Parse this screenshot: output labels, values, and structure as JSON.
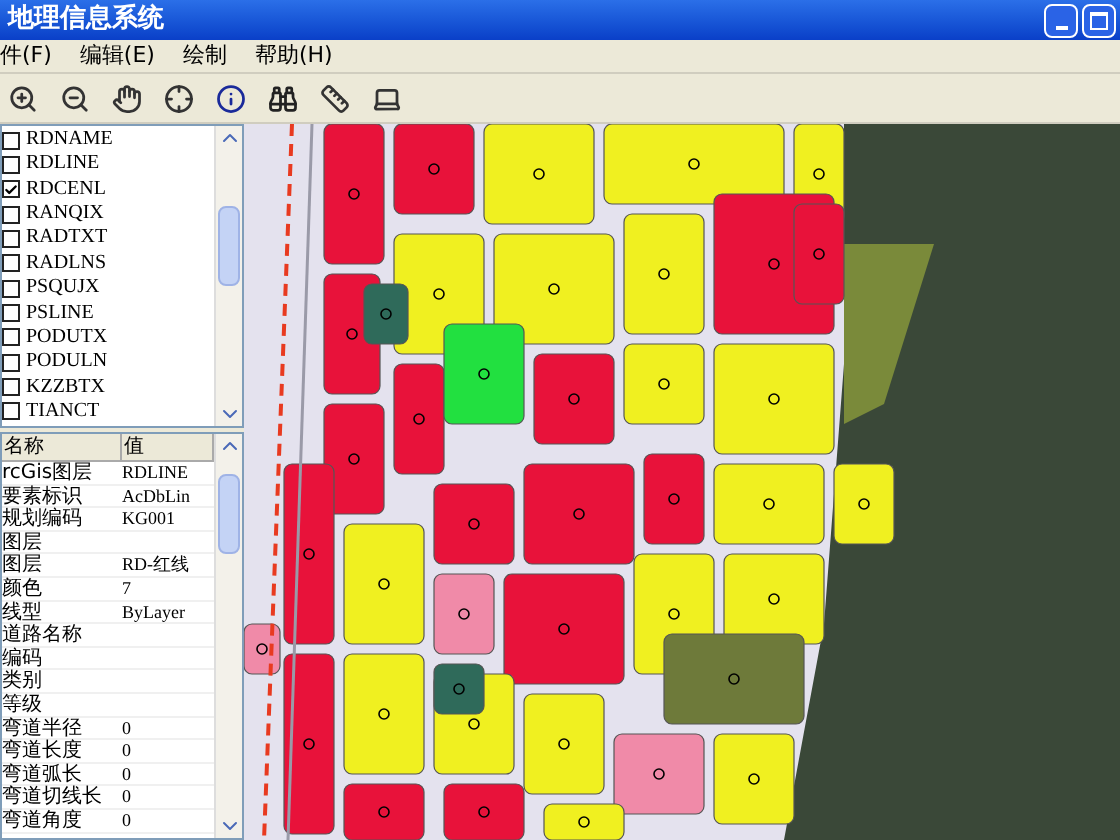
{
  "window": {
    "title": "地理信息系统"
  },
  "menu": [
    {
      "label": "件(F)"
    },
    {
      "label": "编辑(E)"
    },
    {
      "label": "绘制"
    },
    {
      "label": "帮助(H)"
    }
  ],
  "layers": [
    {
      "name": "RDNAME",
      "checked": false
    },
    {
      "name": "RDLINE",
      "checked": false
    },
    {
      "name": "RDCENL",
      "checked": true
    },
    {
      "name": "RANQIX",
      "checked": false
    },
    {
      "name": "RADTXT",
      "checked": false
    },
    {
      "name": "RADLNS",
      "checked": false
    },
    {
      "name": "PSQUJX",
      "checked": false
    },
    {
      "name": "PSLINE",
      "checked": false
    },
    {
      "name": "PODUTX",
      "checked": false
    },
    {
      "name": "PODULN",
      "checked": false
    },
    {
      "name": "KZZBTX",
      "checked": false
    },
    {
      "name": "TIANCT",
      "checked": false
    }
  ],
  "properties": {
    "columns": [
      "名称",
      "值"
    ],
    "rows": [
      {
        "name": "rcGis图层",
        "value": "RDLINE"
      },
      {
        "name": "要素标识",
        "value": "AcDbLin"
      },
      {
        "name": "规划编码",
        "value": "KG001"
      },
      {
        "name": "图层"
      },
      {
        "name": "图层",
        "value": "RD-红线"
      },
      {
        "name": "颜色",
        "value": "7"
      },
      {
        "name": "线型",
        "value": "ByLayer"
      },
      {
        "name": "道路名称"
      },
      {
        "name": "编码"
      },
      {
        "name": "类别"
      },
      {
        "name": "等级"
      },
      {
        "name": "弯道半径",
        "value": "0"
      },
      {
        "name": "弯道长度",
        "value": "0"
      },
      {
        "name": "弯道弧长",
        "value": "0"
      },
      {
        "name": "弯道切线长",
        "value": "0"
      },
      {
        "name": "弯道角度",
        "value": "0"
      }
    ]
  }
}
